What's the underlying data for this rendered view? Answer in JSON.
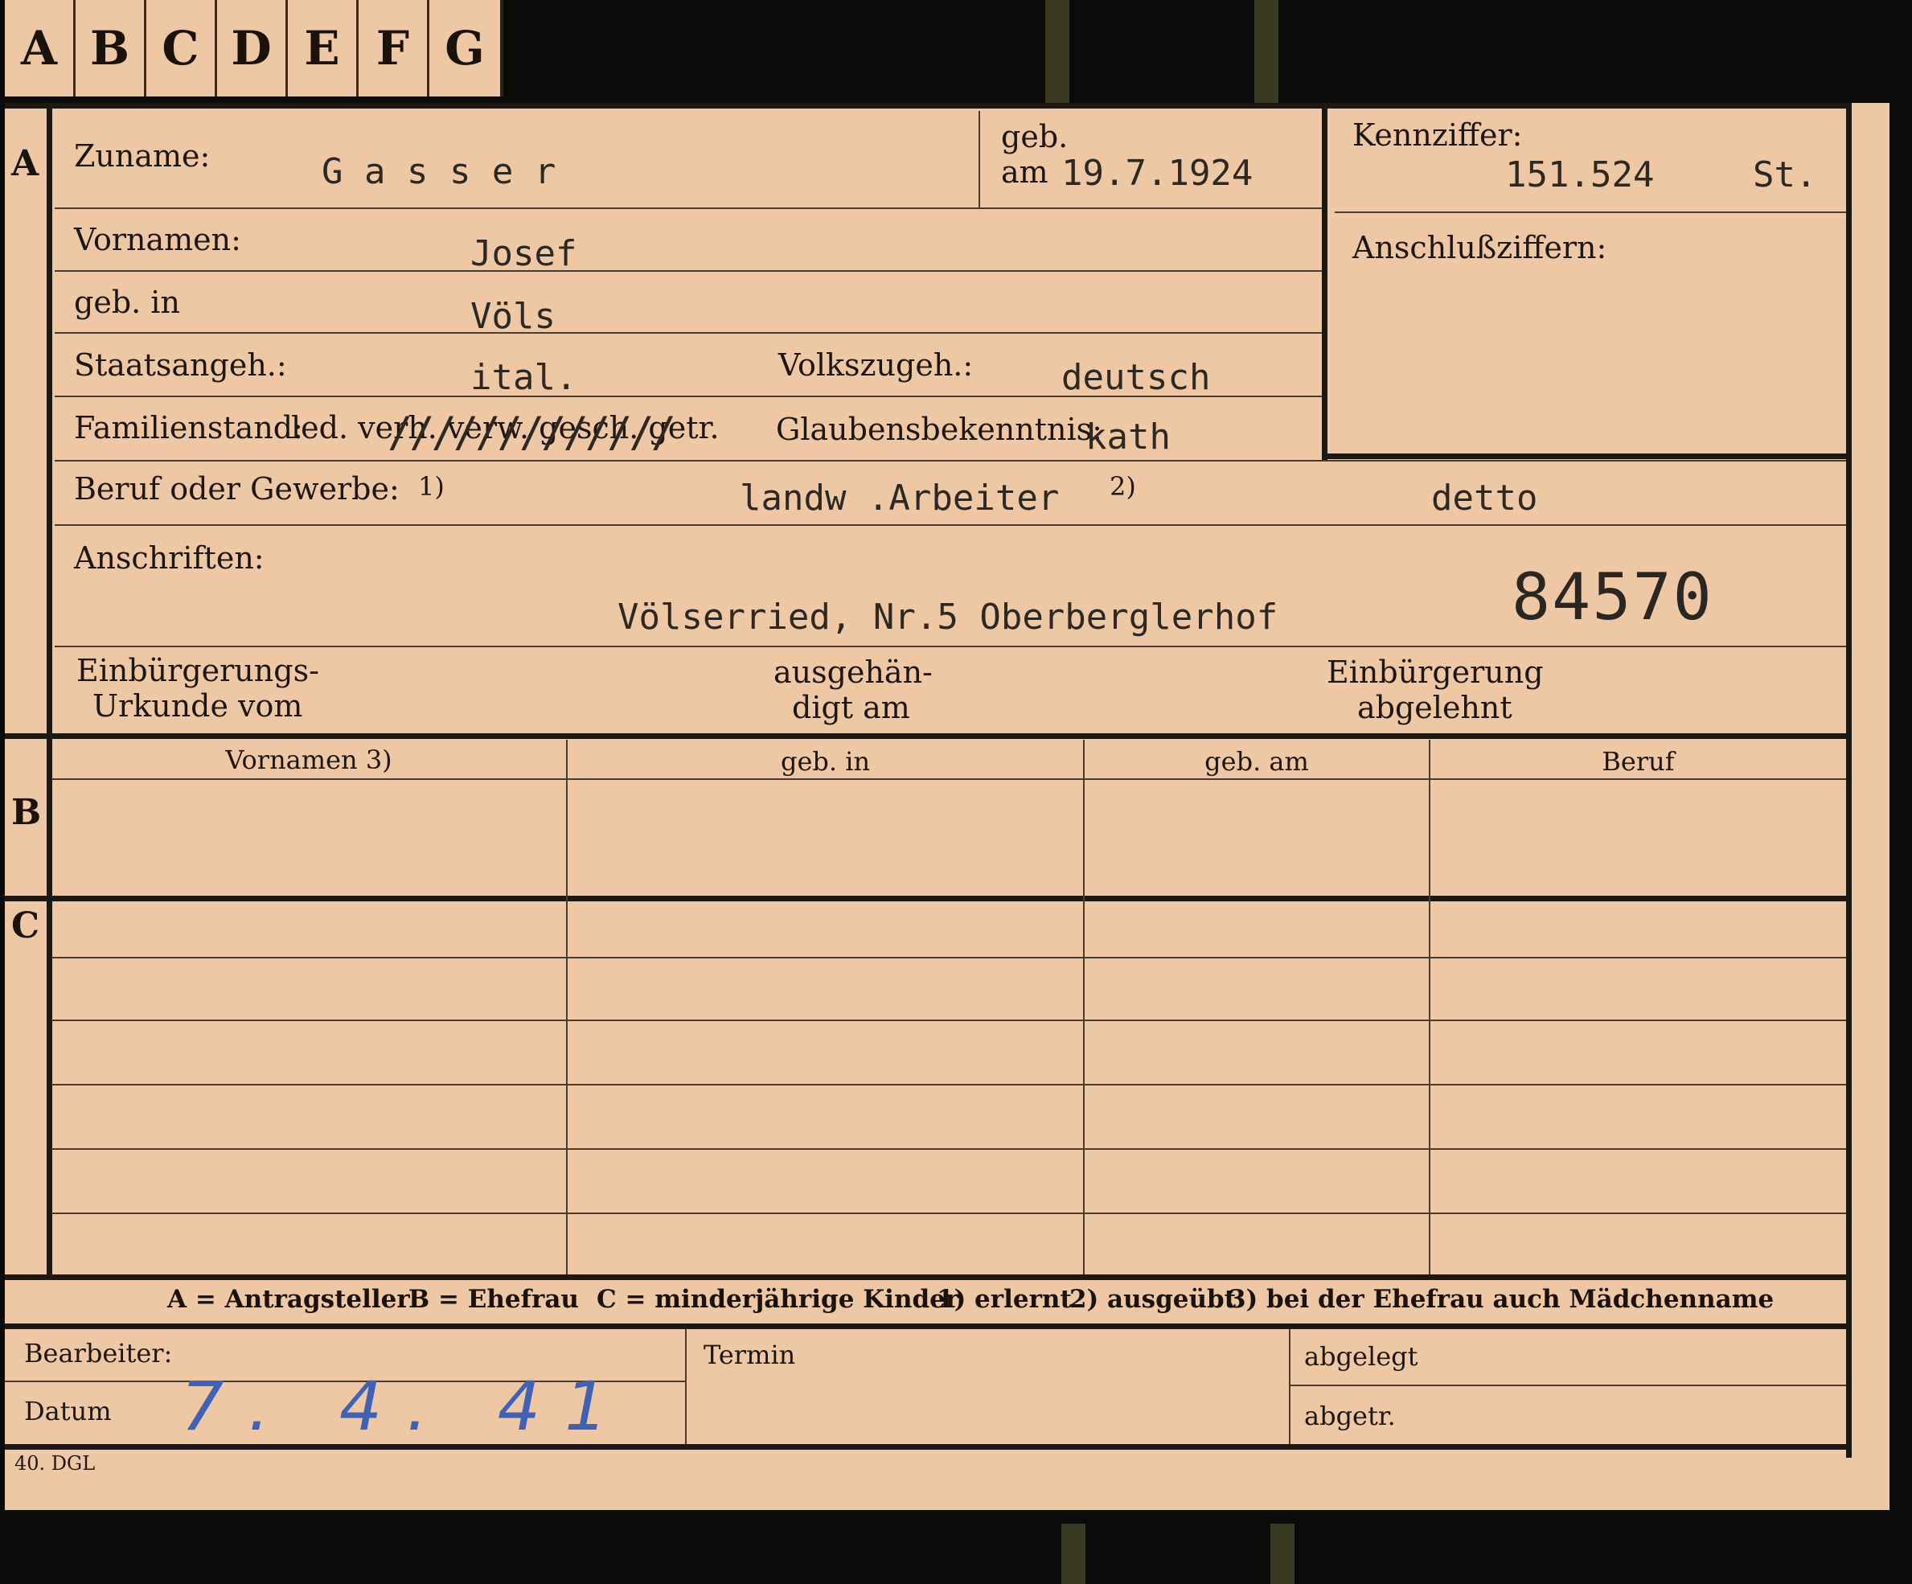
{
  "tabs": [
    "A",
    "B",
    "C",
    "D",
    "E",
    "F",
    "G"
  ],
  "sections": {
    "a": "A",
    "b": "B",
    "c": "C"
  },
  "fields": {
    "zuname_label": "Zuname:",
    "zuname_value": "G a s s e r",
    "geb_label": "geb.",
    "am_label": "am",
    "geb_am_value": "19.7.1924",
    "kennziffer_label": "Kennziffer:",
    "kennziffer_value": "151.524",
    "kennziffer_suffix": "St.",
    "anschluss_label": "Anschlußziffern:",
    "vornamen_label": "Vornamen:",
    "vornamen_value": "Josef",
    "geb_in_label": "geb. in",
    "geb_in_value": "Völs",
    "staatsangeh_label": "Staatsangeh.:",
    "staatsangeh_value": "ital.",
    "volkszugeh_label": "Volkszugeh.:",
    "volkszugeh_value": "deutsch",
    "familienstand_label": "Familienstand:",
    "familienstand_options": "led. verh. verw. gesch. getr.",
    "familienstand_marks": "/////////////",
    "glaubens_label": "Glaubensbekenntnis:",
    "glaubens_value": "kath",
    "beruf_label": "Beruf oder Gewerbe:",
    "note1": "1)",
    "beruf_value": "landw .Arbeiter",
    "note2": "2)",
    "beruf_value2": "detto",
    "anschriften_label": "Anschriften:",
    "anschrift_value": "Völserried,  Nr.5  Oberberglerhof",
    "stamp_number": "84570",
    "einb_urkunde_1": "Einbürgerungs-",
    "einb_urkunde_2": "Urkunde vom",
    "ausgehaen_1": "ausgehän-",
    "ausgehaen_2": "digt am",
    "einb_abgelehnt_1": "Einbürgerung",
    "einb_abgelehnt_2": "abgelehnt"
  },
  "table": {
    "headers": [
      "Vornamen 3)",
      "geb. in",
      "geb. am",
      "Beruf"
    ]
  },
  "legend": {
    "a": "A = Antragsteller",
    "b": "B = Ehefrau",
    "c": "C = minderjährige Kinder",
    "n1": "1) erlernt",
    "n2": "2) ausgeübt",
    "n3": "3) bei der Ehefrau auch Mädchenname"
  },
  "footer": {
    "bearbeiter_label": "Bearbeiter:",
    "datum_label": "Datum",
    "datum_value": "7. 4. 41",
    "termin_label": "Termin",
    "abgelegt_label": "abgelegt",
    "abgetr_label": "abgetr.",
    "form_number": "40. DGL"
  }
}
